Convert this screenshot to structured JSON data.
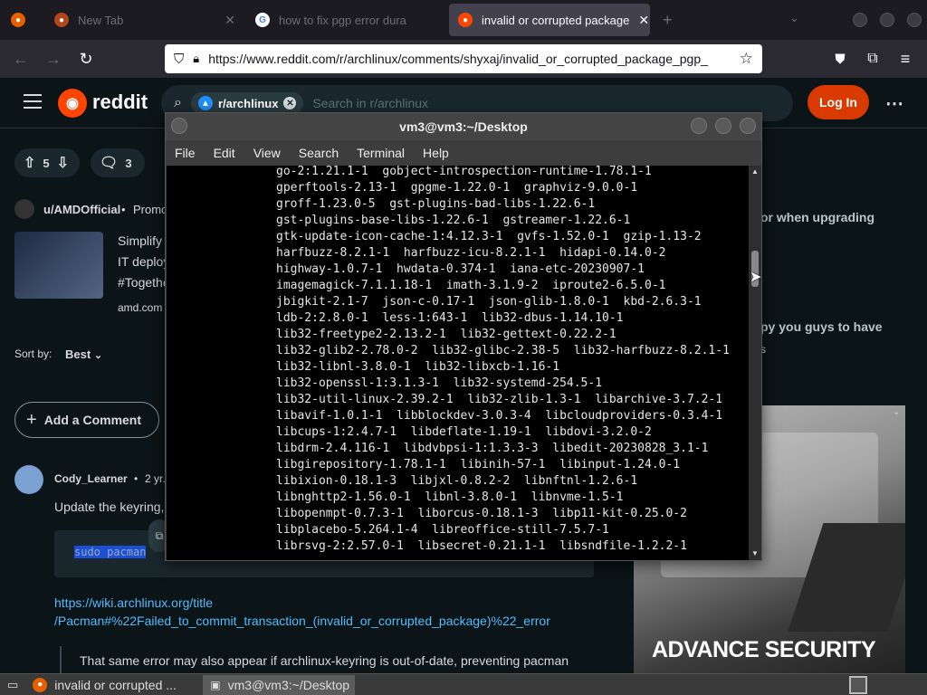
{
  "browser": {
    "tabs": [
      {
        "label": "New Tab",
        "active": false
      },
      {
        "label": "how to fix pgp error dura",
        "active": false
      },
      {
        "label": "invalid or corrupted package",
        "active": true
      }
    ],
    "new_tab_label": "+",
    "url": "https://www.reddit.com/r/archlinux/comments/shyxaj/invalid_or_corrupted_package_pgp_"
  },
  "reddit": {
    "brand": "reddit",
    "search": {
      "chip": "r/archlinux",
      "placeholder": "Search in r/archlinux"
    },
    "login_label": "Log In",
    "upvotes": "5",
    "comments_count": "3",
    "promo": {
      "user": "u/AMDOfficial",
      "tag": "Promo",
      "text_lines": [
        "Simplify",
        "IT deploy",
        "#Togethe"
      ],
      "domain": "amd.com"
    },
    "right_snippets": [
      "or when upgrading",
      "py you guys to have",
      "s"
    ],
    "sort_label": "Sort by:",
    "sort_value": "Best",
    "add_comment_label": "Add a Comment",
    "comment": {
      "user": "Cody_Learner",
      "age": "2 yr.",
      "text": "Update the keyring,",
      "code": "sudo pacman",
      "link_lines": [
        "https://wiki.archlinux.org/title",
        "/Pacman#%22Failed_to_commit_transaction_(invalid_or_corrupted_package)%22_error"
      ],
      "followup": "That same error may also appear if archlinux-keyring is out-of-date, preventing pacman"
    },
    "ad_text": "ADVANCE SECURITY"
  },
  "terminal": {
    "title": "vm3@vm3:~/Desktop",
    "menu": [
      "File",
      "Edit",
      "View",
      "Search",
      "Terminal",
      "Help"
    ],
    "lines": [
      "go-2:1.21.1-1  gobject-introspection-runtime-1.78.1-1",
      "gperftools-2.13-1  gpgme-1.22.0-1  graphviz-9.0.0-1",
      "groff-1.23.0-5  gst-plugins-bad-libs-1.22.6-1",
      "gst-plugins-base-libs-1.22.6-1  gstreamer-1.22.6-1",
      "gtk-update-icon-cache-1:4.12.3-1  gvfs-1.52.0-1  gzip-1.13-2",
      "harfbuzz-8.2.1-1  harfbuzz-icu-8.2.1-1  hidapi-0.14.0-2",
      "highway-1.0.7-1  hwdata-0.374-1  iana-etc-20230907-1",
      "imagemagick-7.1.1.18-1  imath-3.1.9-2  iproute2-6.5.0-1",
      "jbigkit-2.1-7  json-c-0.17-1  json-glib-1.8.0-1  kbd-2.6.3-1",
      "ldb-2:2.8.0-1  less-1:643-1  lib32-dbus-1.14.10-1",
      "lib32-freetype2-2.13.2-1  lib32-gettext-0.22.2-1",
      "lib32-glib2-2.78.0-2  lib32-glibc-2.38-5  lib32-harfbuzz-8.2.1-1",
      "lib32-libnl-3.8.0-1  lib32-libxcb-1.16-1",
      "lib32-openssl-1:3.1.3-1  lib32-systemd-254.5-1",
      "lib32-util-linux-2.39.2-1  lib32-zlib-1.3-1  libarchive-3.7.2-1",
      "libavif-1.0.1-1  libblockdev-3.0.3-4  libcloudproviders-0.3.4-1",
      "libcups-1:2.4.7-1  libdeflate-1.19-1  libdovi-3.2.0-2",
      "libdrm-2.4.116-1  libdvbpsi-1:1.3.3-3  libedit-20230828_3.1-1",
      "libgirepository-1.78.1-1  libinih-57-1  libinput-1.24.0-1",
      "libixion-0.18.1-3  libjxl-0.8.2-2  libnftnl-1.2.6-1",
      "libnghttp2-1.56.0-1  libnl-3.8.0-1  libnvme-1.5-1",
      "libopenmpt-0.7.3-1  liborcus-0.18.1-3  libp11-kit-0.25.0-2",
      "libplacebo-5.264.1-4  libreoffice-still-7.5.7-1",
      "librsvg-2:2.57.0-1  libsecret-0.21.1-1  libsndfile-1.2.2-1"
    ]
  },
  "taskbar": {
    "items": [
      {
        "label": "invalid or corrupted ...",
        "active": false
      },
      {
        "label": "vm3@vm3:~/Desktop",
        "active": true
      }
    ]
  }
}
